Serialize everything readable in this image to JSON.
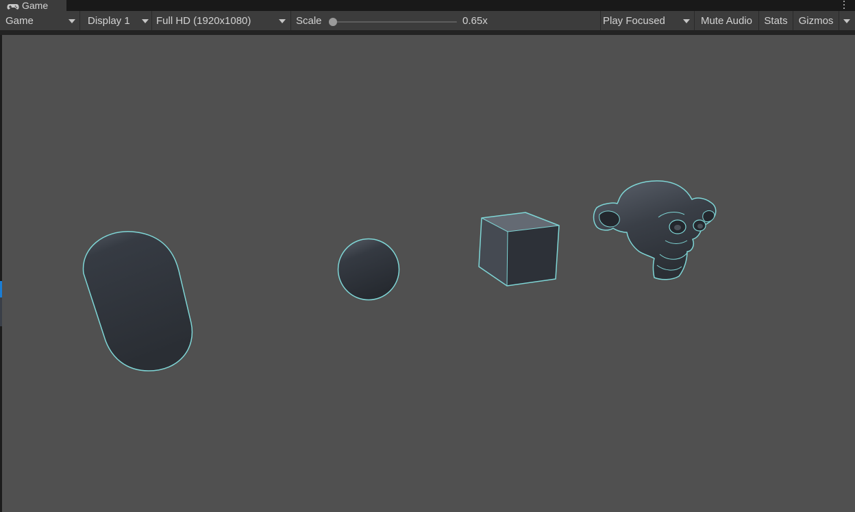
{
  "window": {
    "tab_title": "Game",
    "tab_icon": "gamepad-icon",
    "menu_icon": "kebab-menu-icon"
  },
  "toolbar": {
    "view_mode": "Game",
    "display": "Display 1",
    "resolution": "Full HD (1920x1080)",
    "scale_label": "Scale",
    "scale_value": "0.65x",
    "scale_fraction": 0.0,
    "play_mode": "Play Focused",
    "mute_audio": "Mute Audio",
    "stats": "Stats",
    "gizmos": "Gizmos"
  },
  "scene": {
    "objects": [
      "capsule",
      "sphere",
      "cube",
      "suzanne-monkey-head"
    ],
    "background_color": "#505050",
    "outline_color": "#7fd6d6",
    "object_color": "#2d3138"
  },
  "colors": {
    "toolbar_bg": "#3c3c3c",
    "text": "#d2d2d2",
    "accent_blue": "#1a7ed6"
  }
}
